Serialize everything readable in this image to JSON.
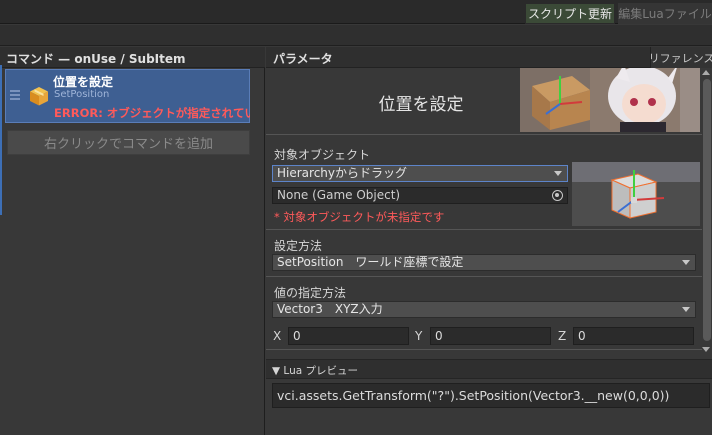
{
  "topbar": {
    "update_button": "スクリプト更新",
    "edit_button": "編集Luaファイル"
  },
  "left": {
    "header": "コマンド — onUse / SubItem",
    "command": {
      "title": "位置を設定",
      "subtitle": "SetPosition",
      "error": "ERROR: オブジェクトが指定されていま"
    },
    "add_command": "右クリックでコマンドを追加"
  },
  "right": {
    "header": "パラメータ",
    "reference_tab": "リファレンス",
    "command_name": "位置を設定",
    "target": {
      "label": "対象オブジェクト",
      "select_value": "Hierarchyからドラッグ",
      "object_field": "None (Game Object)",
      "warning": "* 対象オブジェクトが未指定です"
    },
    "method": {
      "label": "設定方法",
      "select_value": "SetPosition　ワールド座標で設定"
    },
    "value_spec": {
      "label": "値の指定方法",
      "select_value": "Vector3　XYZ入力"
    },
    "xyz": {
      "x_label": "X",
      "x_value": "0",
      "y_label": "Y",
      "y_value": "0",
      "z_label": "Z",
      "z_value": "0"
    },
    "lua_preview": {
      "toggle": "▼ Lua プレビュー",
      "code": "vci.assets.GetTransform(\"?\").SetPosition(Vector3.__new(0,0,0))"
    }
  },
  "colors": {
    "accent_blue": "#3e5f92",
    "error_red": "#ff5a5a",
    "update_green": "#3b4a37"
  },
  "icons": [
    "drag-handle-icon",
    "package-box-icon",
    "object-picker-icon",
    "dropdown-arrow-icon"
  ]
}
